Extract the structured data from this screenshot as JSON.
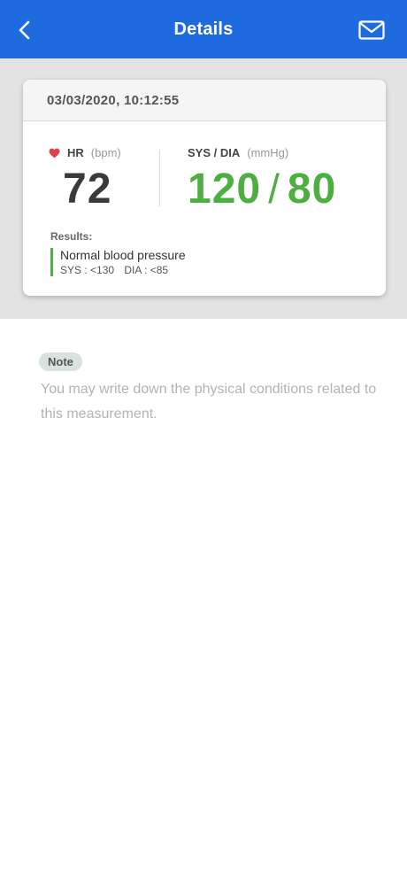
{
  "header": {
    "title": "Details",
    "back_icon": "chevron-left-icon",
    "mail_icon": "mail-icon",
    "background": "#1e6be0"
  },
  "card": {
    "date": "03/03/2020, 10:12:55",
    "hr": {
      "label": "HR",
      "unit": "(bpm)",
      "value": "72",
      "icon": "heart-icon"
    },
    "bp": {
      "label": "SYS / DIA",
      "unit": "(mmHg)",
      "sys": "120",
      "slash": "/",
      "dia": "80",
      "color": "#4caf3f"
    },
    "results": {
      "label": "Results:",
      "title": "Normal blood pressure",
      "sys_range": "SYS : <130",
      "dia_range": "DIA : <85"
    }
  },
  "note": {
    "tag": "Note",
    "placeholder": "You may write down the physical conditions related to this measurement."
  }
}
